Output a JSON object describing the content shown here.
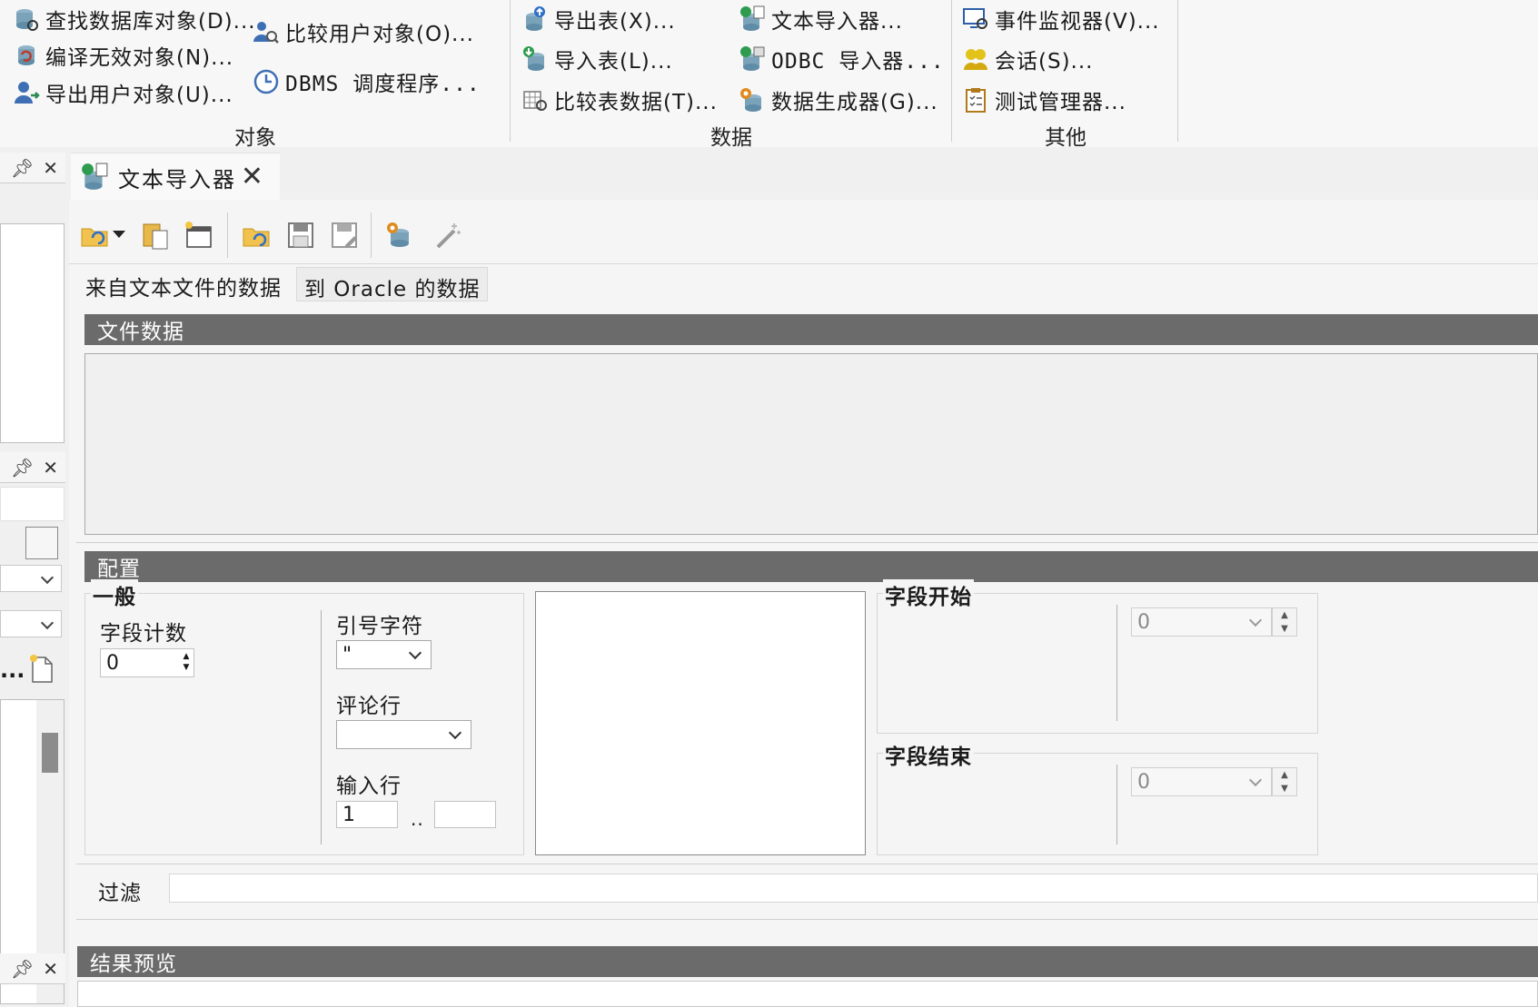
{
  "ribbon": {
    "objects": {
      "label": "对象",
      "find_db_objects": "查找数据库对象(D)...",
      "compile_invalid": "编译无效对象(N)...",
      "export_user_objects": "导出用户对象(U)...",
      "compare_user_objects": "比较用户对象(O)...",
      "dbms_scheduler": "DBMS 调度程序..."
    },
    "data": {
      "label": "数据",
      "export_tables": "导出表(X)...",
      "import_tables": "导入表(L)...",
      "compare_table_data": "比较表数据(T)...",
      "text_importer": "文本导入器...",
      "odbc_importer": "ODBC 导入器...",
      "data_generator": "数据生成器(G)..."
    },
    "other": {
      "label": "其他",
      "event_monitor": "事件监视器(V)...",
      "sessions": "会话(S)...",
      "test_manager": "测试管理器..."
    }
  },
  "left_panel": {
    "ellipsis": "..."
  },
  "tab": {
    "title": "文本导入器",
    "close": "✕"
  },
  "subtabs": {
    "from_text": "来自文本文件的数据",
    "to_oracle": "到 Oracle 的数据"
  },
  "sections": {
    "file_data": "文件数据",
    "config": "配置",
    "results_preview": "结果预览"
  },
  "general": {
    "title": "一般",
    "field_count_label": "字段计数",
    "field_count_value": "0",
    "quote_char_label": "引号字符",
    "quote_char_value": "\"",
    "comment_line_label": "评论行",
    "comment_line_value": "",
    "input_line_label": "输入行",
    "input_line_from": "1",
    "input_line_sep": "..",
    "input_line_to": ""
  },
  "field_start": {
    "title": "字段开始",
    "value": "0"
  },
  "field_end": {
    "title": "字段结束",
    "value": "0"
  },
  "filter": {
    "label": "过滤",
    "value": ""
  },
  "colors": {
    "section_header_bg": "#6b6b6b",
    "ribbon_bg": "#f7f7f7"
  }
}
